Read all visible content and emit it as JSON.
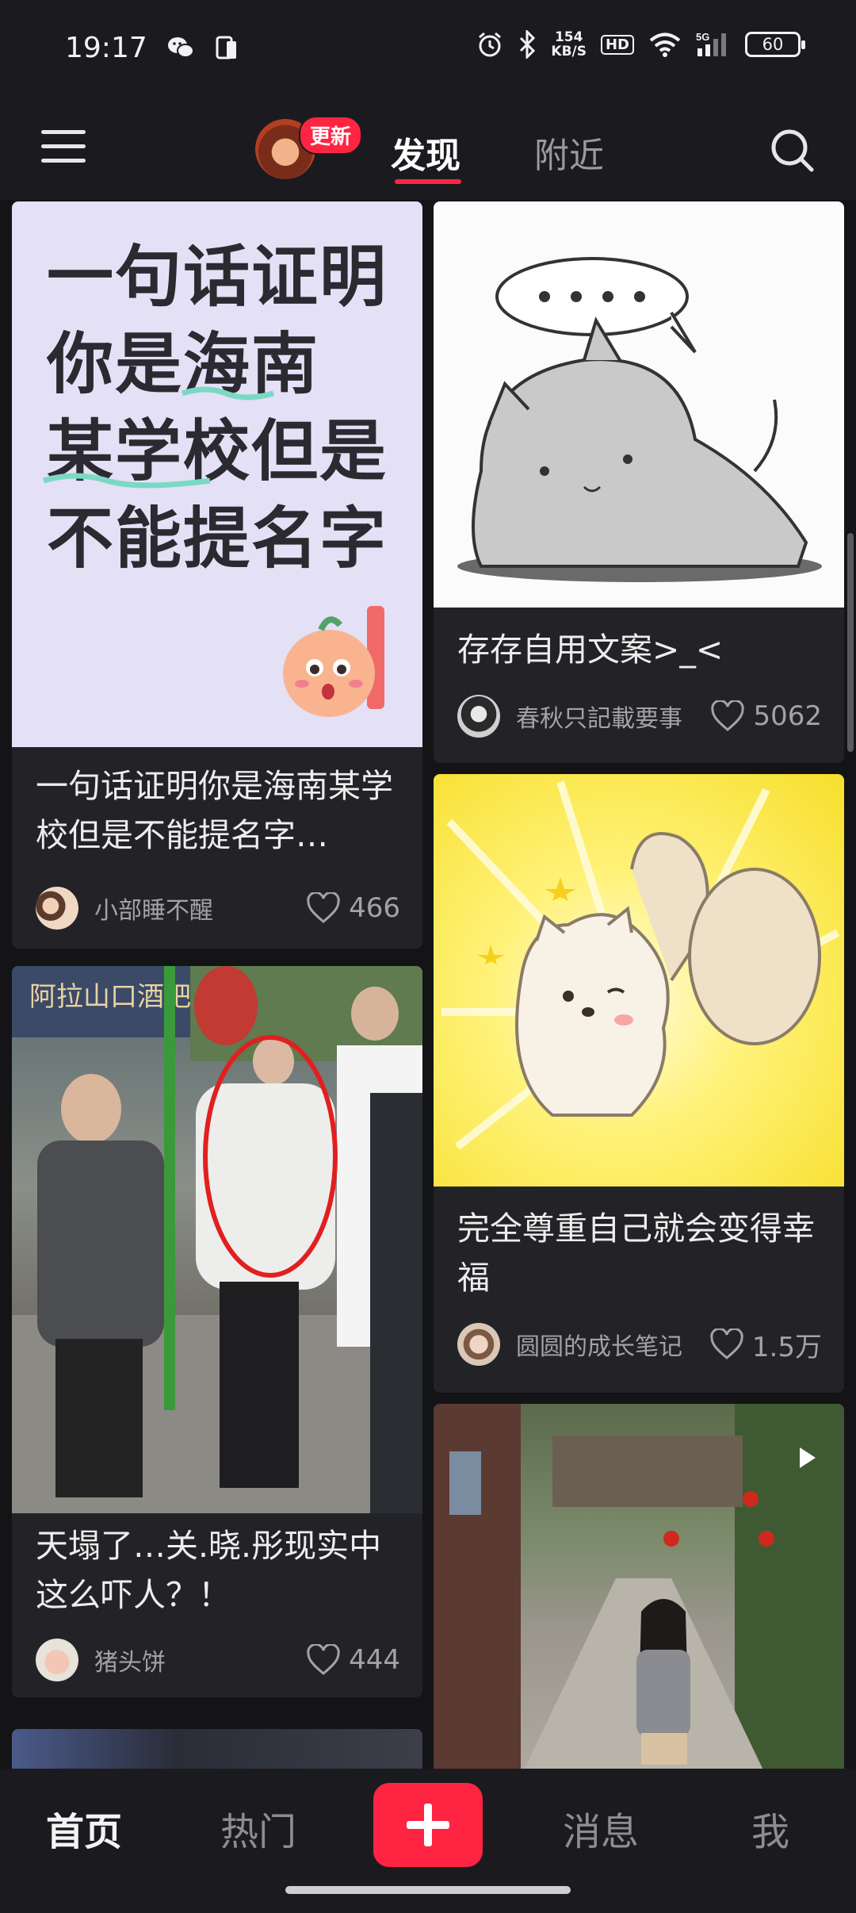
{
  "status_bar": {
    "time": "19:17",
    "speed_value": "154",
    "speed_unit": "KB/S",
    "hd": "HD",
    "network": "5G",
    "battery": "60"
  },
  "header": {
    "badge": "更新",
    "tabs": [
      {
        "label": "发现",
        "active": true
      },
      {
        "label": "附近",
        "active": false
      }
    ]
  },
  "feed": {
    "left": [
      {
        "cover_text": [
          "一句话证明",
          "你是海南",
          "某学校但是",
          "不能提名字"
        ],
        "title": "一句话证明你是海南某学校但是不能提名字…",
        "author": "小部睡不醒",
        "likes": "466"
      },
      {
        "title": "天塌了…关.晓.彤现实中这么吓人？！",
        "author": "猪头饼",
        "likes": "444"
      }
    ],
    "right": [
      {
        "title": "存存自用文案>_<",
        "author": "春秋只記載要事",
        "likes": "5062"
      },
      {
        "title": "完全尊重自己就会变得幸福",
        "author": "圆圆的成长笔记",
        "likes": "1.5万"
      },
      {
        "video": true
      }
    ]
  },
  "bottom_nav": {
    "items": [
      "首页",
      "热门",
      "消息",
      "我"
    ],
    "active": "首页"
  },
  "colors": {
    "accent": "#ff2442",
    "background": "#1b1b1f",
    "card": "#232327"
  }
}
